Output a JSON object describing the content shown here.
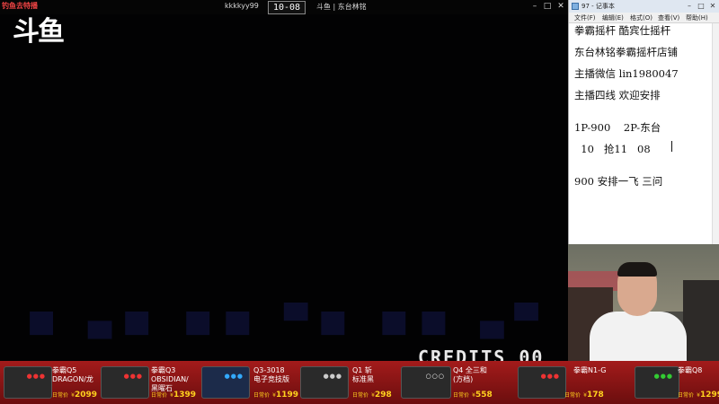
{
  "game": {
    "channel_tag": "钓鱼去特播",
    "logo": "斗鱼",
    "player": "kkkkyy99",
    "score": "10-08",
    "room_name": "斗鱼 | 东台林铭",
    "credits_text": "CREDITS 00",
    "window_buttons": [
      "–",
      "□",
      "✕"
    ]
  },
  "notepad": {
    "title": "97 - 记事本",
    "menu": [
      "文件(F)",
      "编辑(E)",
      "格式(O)",
      "查看(V)",
      "帮助(H)"
    ],
    "lines": [
      "拳霸摇杆 酷宾仕摇杆",
      "东台林铭拳霸摇杆店铺",
      "主播微信 lin1980047",
      "主播四线 欢迎安排",
      "1P-900    2P-东台",
      "  10   抢11   08",
      "900 安排一飞 三问"
    ],
    "window_buttons": [
      "–",
      "□",
      "✕"
    ]
  },
  "ads": [
    {
      "name_line1": "拳霸Q5",
      "name_line2": "DRAGON/龙",
      "price_label": "日常价",
      "price": "2099"
    },
    {
      "name_line1": "拳霸Q3",
      "name_line2": "OBSIDIAN/",
      "name_line3": "黑曜石",
      "price_label": "日常价",
      "price": "1399"
    },
    {
      "name_line1": "Q3-3018",
      "name_line2": "电子竞技版",
      "price_label": "日常价",
      "price": "1199"
    },
    {
      "name_line1": "Q1 斩",
      "name_line2": "标准黑",
      "price_label": "日常价",
      "price": "298"
    },
    {
      "name_line1": "Q4 全三和",
      "name_line2": "(方档)",
      "price_label": "日常价",
      "price": "558"
    },
    {
      "name_line1": "拳霸N1-G",
      "price_label": "日常价",
      "price": "178"
    },
    {
      "name_line1": "拳霸Q8",
      "price_label": "日常价",
      "price": "1299"
    }
  ],
  "currency": "¥"
}
